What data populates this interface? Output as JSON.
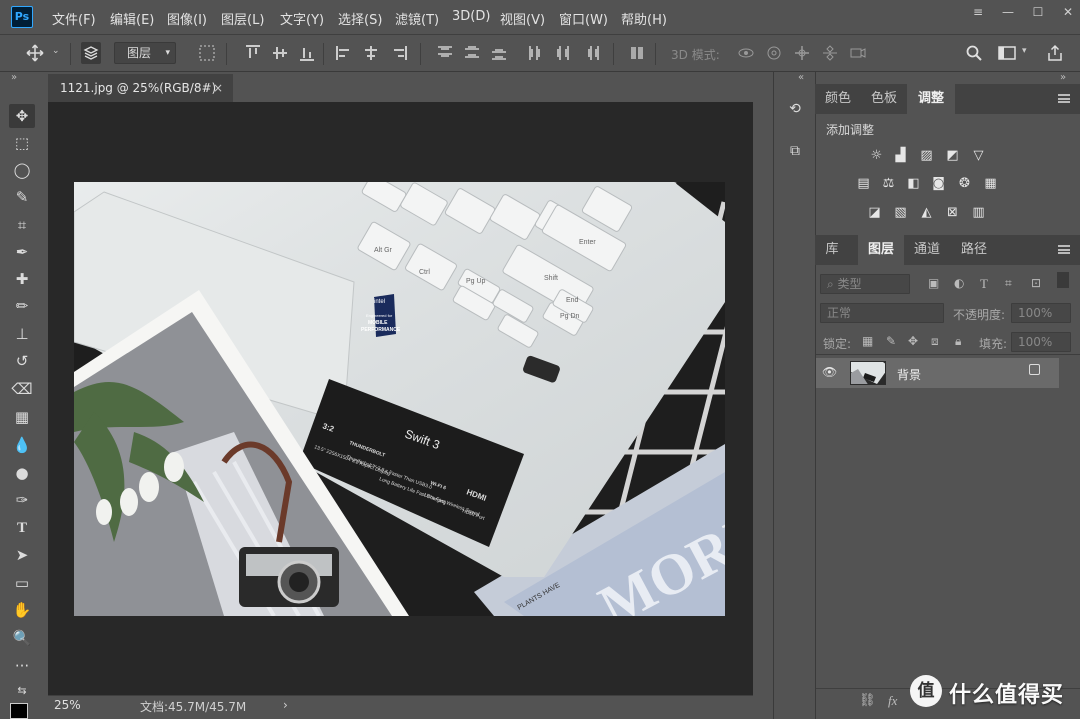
{
  "app": {
    "logo": "Ps"
  },
  "menu": [
    "文件(F)",
    "编辑(E)",
    "图像(I)",
    "图层(L)",
    "文字(Y)",
    "选择(S)",
    "滤镜(T)",
    "3D(D)",
    "视图(V)",
    "窗口(W)",
    "帮助(H)"
  ],
  "window_controls": {
    "more": "≡",
    "minimize": "—",
    "maximize": "☐",
    "close": "✕"
  },
  "options": {
    "layer_select": "图层",
    "mode3d": "3D 模式:"
  },
  "document": {
    "tab_title": "1121.jpg @ 25%(RGB/8#)",
    "close": "×"
  },
  "status": {
    "zoom": "25%",
    "doc_size": "文档:45.7M/45.7M",
    "arrow": "›"
  },
  "panels": {
    "top_tabs": [
      "颜色",
      "色板",
      "调整"
    ],
    "active_top_tab": "调整",
    "adjust_label": "添加调整",
    "layers_tabs": [
      "库",
      "图层",
      "通道",
      "路径"
    ],
    "active_layers_tab": "图层",
    "filter_kind": "类型",
    "blend_mode": "正常",
    "opacity_label": "不透明度:",
    "opacity_value": "100%",
    "lock_label": "锁定:",
    "fill_label": "填充:",
    "fill_value": "100%",
    "layer_name": "背景"
  },
  "image": {
    "laptop_keys": [
      "Alt Gr",
      "Ctrl",
      "Pg Up",
      "Pg Dn",
      "End",
      "Shift",
      "Enter"
    ],
    "intel_badge": [
      "intel",
      "Engineered for",
      "MOBILE",
      "PERFORMANCE"
    ],
    "label_brand": "Swift 3",
    "label_items": [
      "3:2",
      "13.5\" 2256X1504 3:2 Aspect Display",
      "THUNDERBOLT",
      "Thunderbolt™ 3 8 x Faster Than USB3.0",
      "Long Battery Life Fast Charging",
      "WI-FI 6",
      "Ultra-Fast Wireless Speed",
      "HDMI",
      "HDMI Port"
    ],
    "magazine": [
      "MORI",
      "PLANTS HAVE"
    ]
  },
  "watermark": {
    "badge": "值",
    "text": "什么值得买"
  },
  "colors": {
    "ui_bg": "#535353",
    "canvas_bg": "#282828",
    "accent": "#31a8ff"
  }
}
